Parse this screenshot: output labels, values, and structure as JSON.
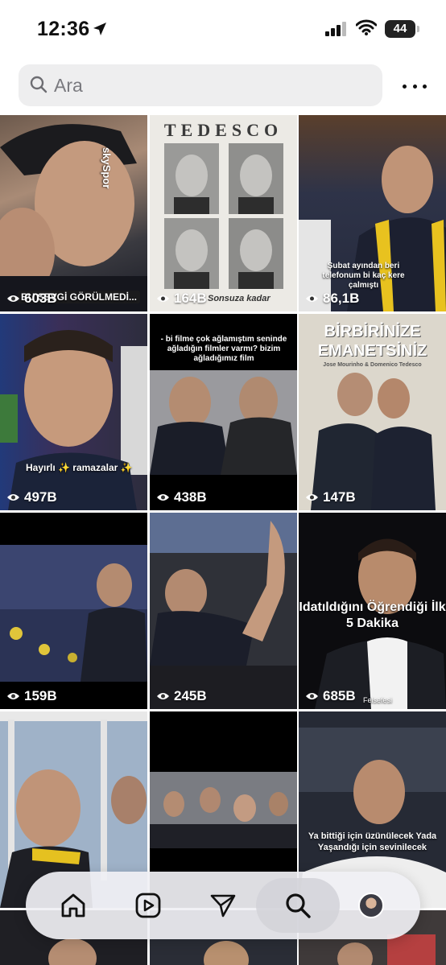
{
  "status_bar": {
    "time": "12:36",
    "battery": "44"
  },
  "search": {
    "placeholder": "Ara"
  },
  "grid": {
    "tiles": [
      {
        "views": "603B",
        "caption": "BU SEVGİ GÖRÜLMEDİ...",
        "watermark": "skySpor"
      },
      {
        "views": "164B",
        "title": "TEDESCO",
        "caption": "Sonsuza kadar"
      },
      {
        "views": "86,1B",
        "caption": "Şubat ayından beri telefonum bi kaç kere çalmıştı"
      },
      {
        "views": "497B",
        "caption": "Hayırlı ✨ ramazalar ✨"
      },
      {
        "views": "438B",
        "caption": "- bi filme çok ağlamıştım seninde ağladığın filmler varmı? bizim ağladığımız film"
      },
      {
        "views": "147B",
        "title": "BİRBİRİNİZE EMANETSİNİZ",
        "subtitle": "Jose Mourinho & Domenico Tedesco"
      },
      {
        "views": "159B"
      },
      {
        "views": "245B"
      },
      {
        "views": "685B",
        "caption": "Idatıldığını Öğrendiği İlk 5 Dakika",
        "watermark": "Felsefesi"
      },
      {
        "views": ""
      },
      {
        "views": ""
      },
      {
        "views": "",
        "caption": "Ya bittiği için üzünülecek Yada Yaşandığı için sevinilecek"
      }
    ]
  },
  "nav": {
    "items": [
      "home-icon",
      "reels-icon",
      "send-icon",
      "search-icon",
      "profile-avatar"
    ]
  }
}
